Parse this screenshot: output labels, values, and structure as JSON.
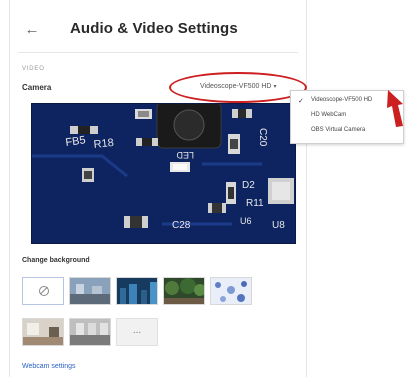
{
  "header": {
    "back_icon": "arrow-left-icon",
    "title": "Audio & Video Settings"
  },
  "video_section": {
    "section_label": "VIDEO",
    "camera_label": "Camera",
    "camera_selected": "Videoscope-VF500 HD",
    "chevron_icon": "chevron-down-icon"
  },
  "camera_dropdown": {
    "options": [
      "Videoscope-VF500 HD",
      "HD WebCam",
      "OBS Virtual Camera"
    ],
    "check_icon": "checkmark-icon"
  },
  "preview": {
    "board_labels": [
      "FB5",
      "R18",
      "C20",
      "D2",
      "R11",
      "C28",
      "U8",
      "U6",
      "LED"
    ]
  },
  "background": {
    "label": "Change background",
    "options": [
      "none",
      "office",
      "city",
      "garden",
      "dots",
      "room",
      "hall",
      "more"
    ],
    "more_label": "..."
  },
  "footer": {
    "webcam_link": "Webcam settings"
  },
  "colors": {
    "accent": "#2d62c4",
    "annotation": "#cc1f1f",
    "pcb": "#0e2460"
  }
}
